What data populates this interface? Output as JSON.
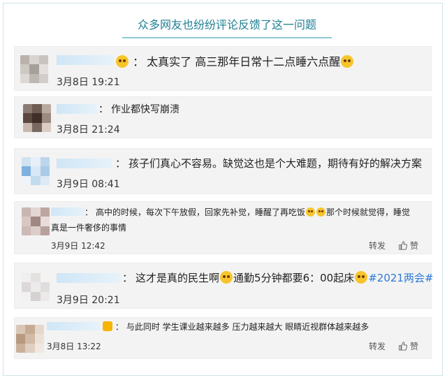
{
  "header": {
    "title": "众多网友也纷纷评论反馈了这一问题"
  },
  "comments": [
    {
      "text": "太真实了 高三那年日常十二点睡六点醒",
      "colon": "：",
      "time": "3月8日 19:21"
    },
    {
      "text": "作业都快写崩溃",
      "colon": "：",
      "time": "3月8日 21:24"
    },
    {
      "text": "孩子们真心不容易。缺觉这也是个大难题，期待有好的解决方案",
      "colon": "：",
      "time": "3月9日 08:41"
    },
    {
      "text_part1": "高中的时候，每次下午放假，回家先补觉，睡醒了再吃饭",
      "text_part2": "那个时候就觉得，睡觉",
      "text_line2": "真是一件奢侈的事情",
      "colon": "：",
      "time": "3月9日 12:42",
      "repost": "转发",
      "like": "赞"
    },
    {
      "text_part1": "这才是真的民生啊",
      "text_part2": "通勤5分钟都要6：00起床",
      "hashtag": "#2021两会#",
      "colon": "：",
      "time": "3月9日 20:21"
    },
    {
      "text": "与此同时 学生课业越来越多 压力越来越大 眼睛近视群体越来越多",
      "colon": "：",
      "time": "3月8日 13:22",
      "repost": "转发",
      "like": "赞"
    }
  ],
  "icons": {
    "emoji": "emoji-icon",
    "thumb": "thumb-up-icon",
    "vip": "vip-badge-icon"
  }
}
